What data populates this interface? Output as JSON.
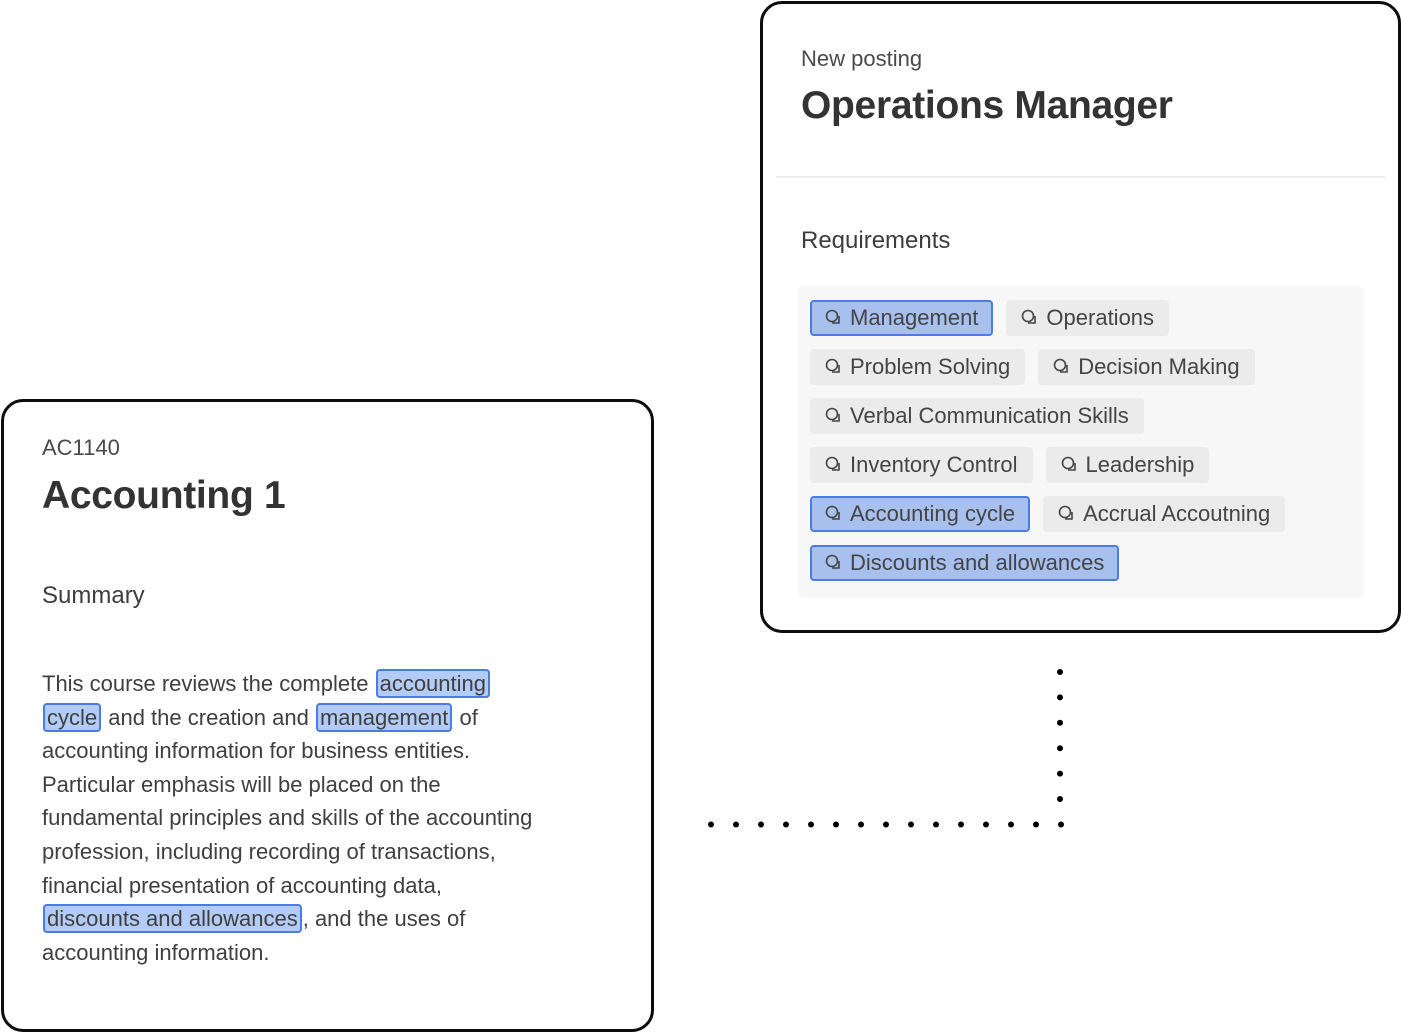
{
  "posting": {
    "eyebrow": "New posting",
    "title": "Operations Manager",
    "section_label": "Requirements",
    "tag_icon": "skill-tag-icon",
    "tag_rows": [
      [
        {
          "label": "Management",
          "matched": true
        },
        {
          "label": "Operations",
          "matched": false
        }
      ],
      [
        {
          "label": "Problem Solving",
          "matched": false
        },
        {
          "label": "Decision Making",
          "matched": false
        }
      ],
      [
        {
          "label": "Verbal Communication Skills",
          "matched": false
        }
      ],
      [
        {
          "label": "Inventory Control",
          "matched": false
        },
        {
          "label": "Leadership",
          "matched": false
        }
      ],
      [
        {
          "label": "Accounting cycle",
          "matched": true
        },
        {
          "label": "Accrual Accoutning",
          "matched": false
        }
      ],
      [
        {
          "label": "Discounts and allowances",
          "matched": true
        }
      ]
    ]
  },
  "course": {
    "code": "AC1140",
    "title": "Accounting 1",
    "section_label": "Summary",
    "summary_lines": [
      [
        {
          "text": "This course reviews the complete "
        },
        {
          "text": "accounting ",
          "highlight": true
        }
      ],
      [
        {
          "text": "cycle",
          "highlight": true
        },
        {
          "text": " and the creation and "
        },
        {
          "text": "management",
          "highlight": true
        },
        {
          "text": " of"
        }
      ],
      [
        {
          "text": "accounting information for business entities."
        }
      ],
      [
        {
          "text": "Particular emphasis will be placed on the"
        }
      ],
      [
        {
          "text": "fundamental principles and skills of the accounting"
        }
      ],
      [
        {
          "text": "profession, including recording of transactions,"
        }
      ],
      [
        {
          "text": "financial presentation of accounting data,"
        }
      ],
      [
        {
          "text": "discounts and allowances",
          "highlight": true
        },
        {
          "text": ", and the uses of"
        }
      ],
      [
        {
          "text": "accounting information."
        }
      ]
    ]
  },
  "colors": {
    "match_fill": "#a8c0ee",
    "match_border": "#4b7be6",
    "tag_fill": "#ebebeb",
    "connector": "#000000"
  }
}
